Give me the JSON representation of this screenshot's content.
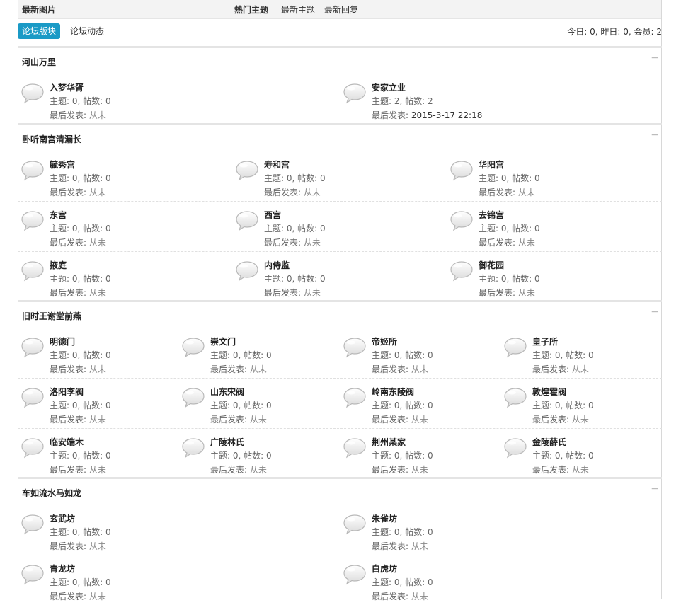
{
  "topbar": {
    "latest_pictures": "最新图片",
    "hot_threads": "熱门主题",
    "new_threads": "最新主题",
    "new_replies": "最新回复"
  },
  "nav": {
    "tab_boards": "论坛版块",
    "tab_activity": "论坛动态",
    "stats": "今日: 0, 昨日: 0, 会员: 2"
  },
  "labels": {
    "last_post_prefix": "最后发表: ",
    "collapse": "−"
  },
  "categories": [
    {
      "title": "河山万里",
      "rows": [
        [
          {
            "name": "入梦华胥",
            "counts": "主题: 0, 帖数: 0",
            "last": "从未"
          },
          {
            "name": "安家立业",
            "counts": "主题: 2, 帖数: 2",
            "last": "2015-3-17 22:18"
          }
        ]
      ]
    },
    {
      "title": "卧听南宫清漏长",
      "rows": [
        [
          {
            "name": "毓秀宫",
            "counts": "主题: 0, 帖数: 0",
            "last": "从未"
          },
          {
            "name": "寿和宫",
            "counts": "主题: 0, 帖数: 0",
            "last": "从未"
          },
          {
            "name": "华阳宫",
            "counts": "主题: 0, 帖数: 0",
            "last": "从未"
          }
        ],
        [
          {
            "name": "东宫",
            "counts": "主题: 0, 帖数: 0",
            "last": "从未"
          },
          {
            "name": "西宫",
            "counts": "主题: 0, 帖数: 0",
            "last": "从未"
          },
          {
            "name": "去锦宫",
            "counts": "主题: 0, 帖数: 0",
            "last": "从未"
          }
        ],
        [
          {
            "name": "掖庭",
            "counts": "主题: 0, 帖数: 0",
            "last": "从未"
          },
          {
            "name": "内侍监",
            "counts": "主题: 0, 帖数: 0",
            "last": "从未"
          },
          {
            "name": "御花园",
            "counts": "主题: 0, 帖数: 0",
            "last": "从未"
          }
        ]
      ]
    },
    {
      "title": "旧时王谢堂前燕",
      "rows": [
        [
          {
            "name": "明德门",
            "counts": "主题: 0, 帖数: 0",
            "last": "从未"
          },
          {
            "name": "崇文门",
            "counts": "主题: 0, 帖数: 0",
            "last": "从未"
          },
          {
            "name": "帝姬所",
            "counts": "主题: 0, 帖数: 0",
            "last": "从未"
          },
          {
            "name": "皇子所",
            "counts": "主题: 0, 帖数: 0",
            "last": "从未"
          }
        ],
        [
          {
            "name": "洛阳李阀",
            "counts": "主题: 0, 帖数: 0",
            "last": "从未"
          },
          {
            "name": "山东宋阀",
            "counts": "主题: 0, 帖数: 0",
            "last": "从未"
          },
          {
            "name": "岭南东陵阀",
            "counts": "主题: 0, 帖数: 0",
            "last": "从未"
          },
          {
            "name": "敦煌霍阀",
            "counts": "主题: 0, 帖数: 0",
            "last": "从未"
          }
        ],
        [
          {
            "name": "临安端木",
            "counts": "主题: 0, 帖数: 0",
            "last": "从未"
          },
          {
            "name": "广陵林氏",
            "counts": "主题: 0, 帖数: 0",
            "last": "从未"
          },
          {
            "name": "荆州某家",
            "counts": "主题: 0, 帖数: 0",
            "last": "从未"
          },
          {
            "name": "金陵薛氏",
            "counts": "主题: 0, 帖数: 0",
            "last": "从未"
          }
        ]
      ]
    },
    {
      "title": "车如流水马如龙",
      "rows": [
        [
          {
            "name": "玄武坊",
            "counts": "主题: 0, 帖数: 0",
            "last": "从未"
          },
          {
            "name": "朱雀坊",
            "counts": "主题: 0, 帖数: 0",
            "last": "从未"
          }
        ],
        [
          {
            "name": "青龙坊",
            "counts": "主题: 0, 帖数: 0",
            "last": "从未"
          },
          {
            "name": "白虎坊",
            "counts": "主题: 0, 帖数: 0",
            "last": "从未"
          }
        ]
      ]
    }
  ]
}
